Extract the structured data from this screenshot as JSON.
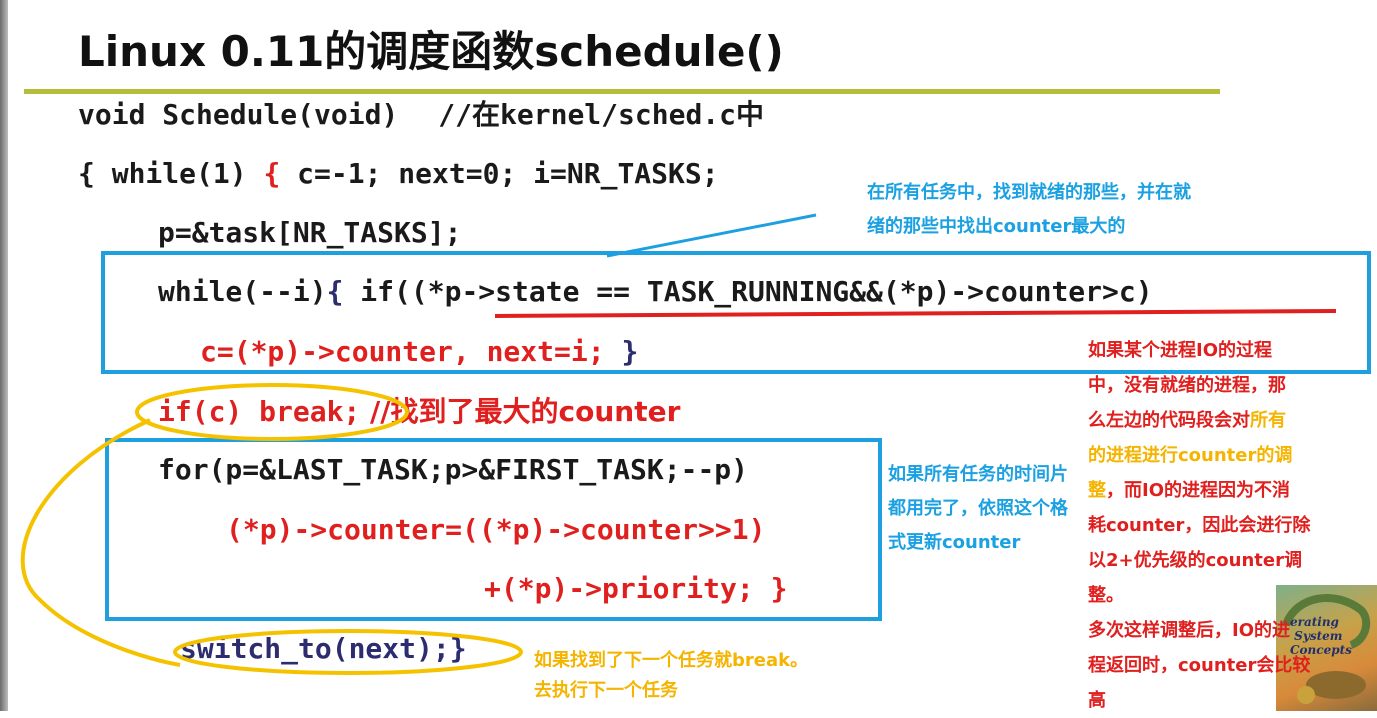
{
  "title": "Linux 0.11的调度函数schedule()",
  "code": {
    "line1_code": "void Schedule(void)",
    "line1_comment": "//在kernel/sched.c中",
    "line2_a": "{ while(1) ",
    "line2_b": "{",
    "line2_c": " c=-1; next=0; i=NR_TASKS;",
    "line3": "p=&task[NR_TASKS];",
    "line4_a": "while(--i)",
    "line4_b": "{",
    "line4_c": " if((*p->state == TASK_RUNNING&&(*p)->counter>c)",
    "line5_a": "c=(*p)->counter, next=i; ",
    "line5_b": "}",
    "line6_code": "if(c) break;",
    "line6_comment": " //找到了最大的counter",
    "line7": "for(p=&LAST_TASK;p>&FIRST_TASK;--p)",
    "line8": "(*p)->counter=((*p)->counter>>1)",
    "line9_a": "+(*p)->priority; ",
    "line9_b": "}",
    "line10": "switch_to(next);}"
  },
  "notes": {
    "top_blue": [
      "在所有任务中，找到就绪的那些，并在就",
      "绪的那些中找出counter最大的"
    ],
    "mid_blue": [
      "如果所有任务的时间片",
      "都用完了，依照这个格",
      "式更新counter"
    ],
    "bottom_orange": [
      "如果找到了下一个任务就break。",
      "去执行下一个任务"
    ],
    "right_red": {
      "l1": "如果某个进程IO的过程",
      "l2": "中，没有就绪的进程，那",
      "l3a": "么左边的代码段会对",
      "l3b": "所有",
      "l4a": "的进程进行counter的调",
      "l5a": "整",
      "l5b": "，而IO的进程因为不消",
      "l6": "耗counter，因此会进行除",
      "l7": "以2+优先级的counter调",
      "l8": "整。",
      "l9": "多次这样调整后，IO的进",
      "l10": "程返回时，counter会比较",
      "l11": "高"
    }
  },
  "book_cover": "erating\n System\nConcepts",
  "colors": {
    "accent_blue": "#1ea0e0",
    "accent_red": "#e0201f",
    "accent_yellow": "#f5c200",
    "title_rule": "#b5bd3a"
  }
}
